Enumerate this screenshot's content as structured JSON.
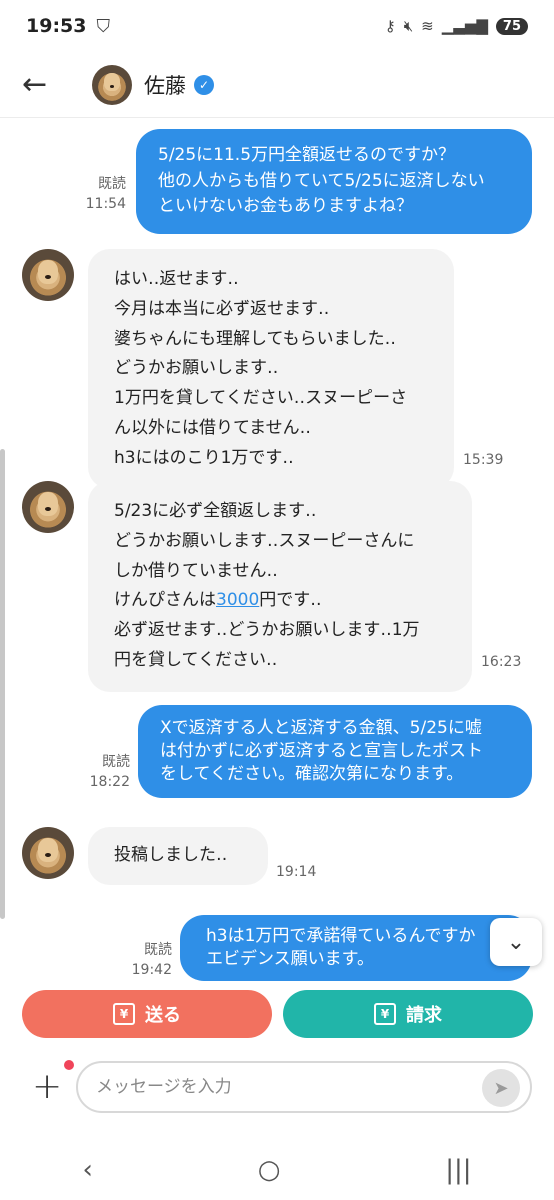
{
  "status_bar": {
    "time": "19:53",
    "battery": "75",
    "icons": [
      "shield-icon",
      "key-icon",
      "mute-icon",
      "wifi-icon",
      "signal-icon"
    ]
  },
  "header": {
    "contact_name": "佐藤",
    "verified": true
  },
  "messages": [
    {
      "direction": "out",
      "lines": [
        "5/25に11.5万円全額返せるのですか？",
        "他の人からも借りていて5/25に返済しない",
        "といけないお金もありますよね？"
      ],
      "read_label": "既読",
      "time": "11:54"
    },
    {
      "direction": "in",
      "lines": [
        "はい‥返せます‥",
        "今月は本当に必ず返せます‥",
        "婆ちゃんにも理解してもらいました‥",
        "どうかお願いします‥",
        "1万円を貸してください‥スヌーピーさ",
        "ん以外には借りてません‥",
        "h3にはのこり1万です‥"
      ],
      "time": "15:39"
    },
    {
      "direction": "in",
      "lines": [
        "5/23に必ず全額返します‥",
        "どうかお願いします‥スヌーピーさんに",
        "しか借りていません‥",
        "けんぴさんは",
        "必ず返せます‥どうかお願いします‥1万",
        "円を貸してください‥"
      ],
      "link_text": "3000",
      "link_suffix": "円です‥",
      "time": "16:23"
    },
    {
      "direction": "out",
      "lines": [
        "Xで返済する人と返済する金額、5/25に嘘",
        "は付かずに必ず返済すると宣言したポスト",
        "をしてください。確認次第になります。"
      ],
      "read_label": "既読",
      "time": "18:22"
    },
    {
      "direction": "in",
      "lines": [
        "投稿しました‥"
      ],
      "time": "19:14"
    },
    {
      "direction": "out",
      "lines": [
        "h3は1万円で承諾得ているんですか",
        "エビデンス願います。"
      ],
      "read_label": "既読",
      "time": "19:42"
    }
  ],
  "buttons": {
    "send": "送る",
    "request": "請求",
    "send_icon_glyph": "¥",
    "request_icon_glyph": "¥"
  },
  "input": {
    "placeholder": "メッセージを入力",
    "value": ""
  },
  "colors": {
    "outgoing_bubble": "#2f8fe7",
    "incoming_bubble": "#f3f3f3",
    "send_button": "#f2715f",
    "request_button": "#21b5a9",
    "verified_badge": "#2f8fe7"
  }
}
